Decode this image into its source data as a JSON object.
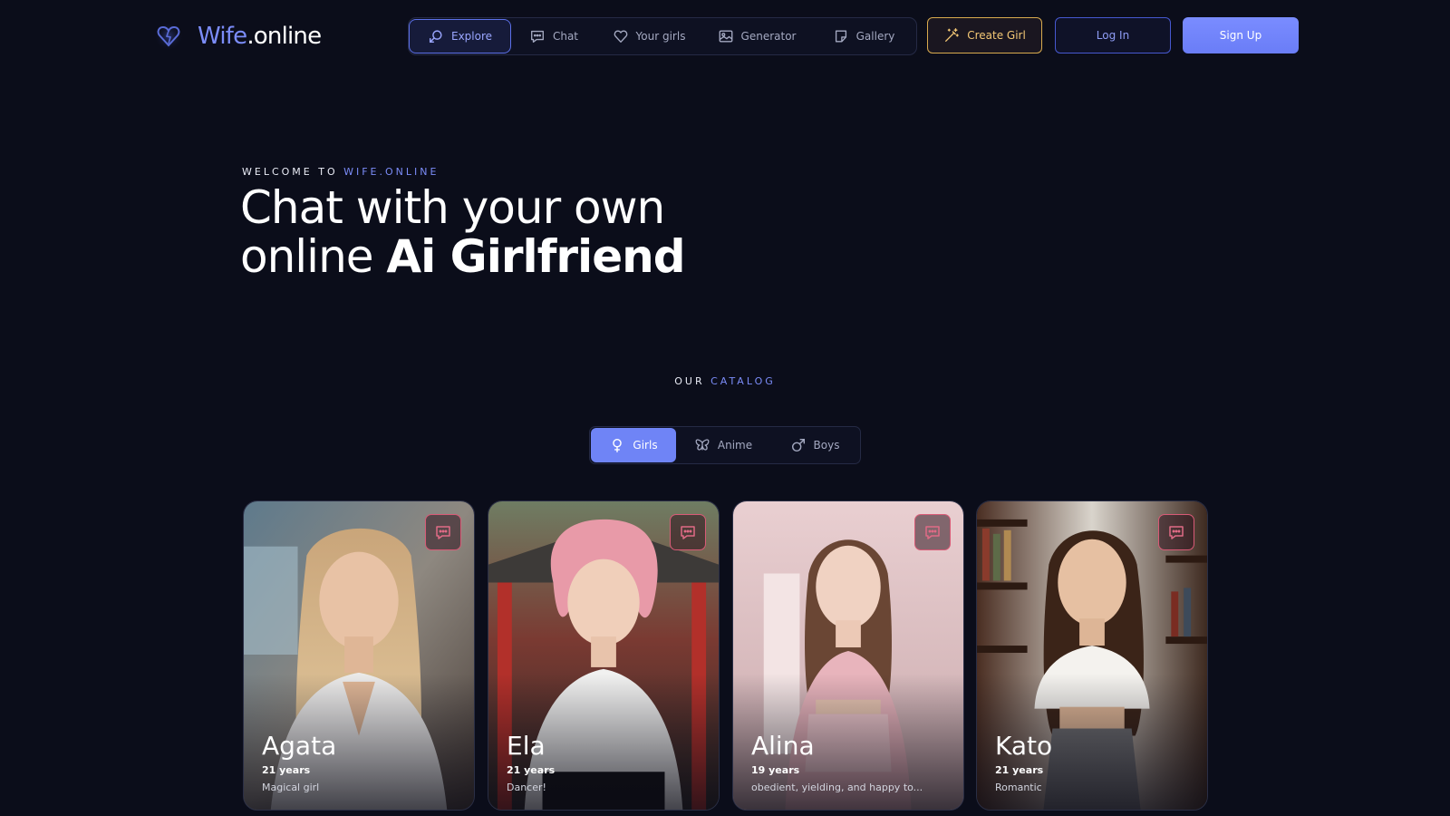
{
  "brand": {
    "name_accent": "Wife",
    "name_rest": ".online"
  },
  "nav": {
    "items": [
      {
        "label": "Explore",
        "icon": "explore-icon",
        "active": true
      },
      {
        "label": "Chat",
        "icon": "chat-icon"
      },
      {
        "label": "Your girls",
        "icon": "heart-icon"
      },
      {
        "label": "Generator",
        "icon": "image-icon"
      },
      {
        "label": "Gallery",
        "icon": "sticker-icon"
      }
    ]
  },
  "actions": {
    "create_label": "Create Girl",
    "login_label": "Log In",
    "signup_label": "Sign Up"
  },
  "hero": {
    "eyebrow_prefix": "WELCOME TO ",
    "eyebrow_accent": "WIFE.ONLINE",
    "title_line1": "Chat with your own",
    "title_line2_regular": "online ",
    "title_line2_bold": "Ai Girlfriend"
  },
  "catalog": {
    "label_prefix": "OUR ",
    "label_accent": "CATALOG",
    "tabs": [
      {
        "label": "Girls",
        "icon": "female-icon",
        "active": true
      },
      {
        "label": "Anime",
        "icon": "butterfly-icon"
      },
      {
        "label": "Boys",
        "icon": "male-icon"
      }
    ]
  },
  "cards": [
    {
      "name": "Agata",
      "age": "21 years",
      "description": "Magical girl"
    },
    {
      "name": "Ela",
      "age": "21 years",
      "description": "Dancer!"
    },
    {
      "name": "Alina",
      "age": "19 years",
      "description": "obedient, yielding, and happy to..."
    },
    {
      "name": "Kato",
      "age": "21 years",
      "description": "Romantic"
    }
  ],
  "colors": {
    "background": "#0b0d1a",
    "accent": "#7b8cf8",
    "create_gold": "#d8aa4e",
    "chat_pink": "#d85a76"
  }
}
